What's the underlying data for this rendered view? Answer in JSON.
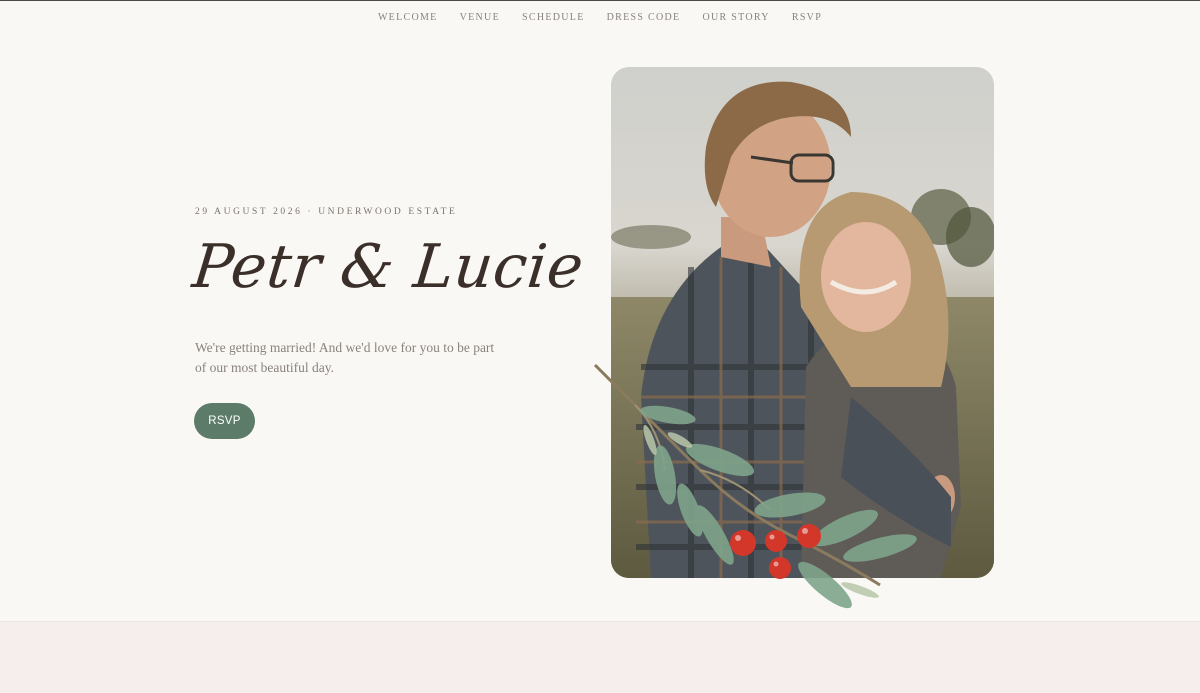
{
  "nav": {
    "items": [
      {
        "label": "WELCOME"
      },
      {
        "label": "VENUE"
      },
      {
        "label": "SCHEDULE"
      },
      {
        "label": "DRESS CODE"
      },
      {
        "label": "OUR STORY"
      },
      {
        "label": "RSVP"
      }
    ]
  },
  "hero": {
    "eyebrow": "29 AUGUST 2026 · UNDERWOOD ESTATE",
    "names": "Petr & Lucie",
    "tagline": "We're getting married! And we'd love for you to be part of our most beautiful day.",
    "rsvp_label": "RSVP"
  },
  "colors": {
    "background": "#faf8f5",
    "accent_green": "#5c7b69",
    "text_dark": "#3b2f2a",
    "text_muted": "#8a827c",
    "footer_band": "#f6eeec",
    "berry_red": "#d2372a"
  },
  "images": {
    "hero_photo": "engaged couple embracing outdoors",
    "decoration": "olive sprig with red berries"
  }
}
